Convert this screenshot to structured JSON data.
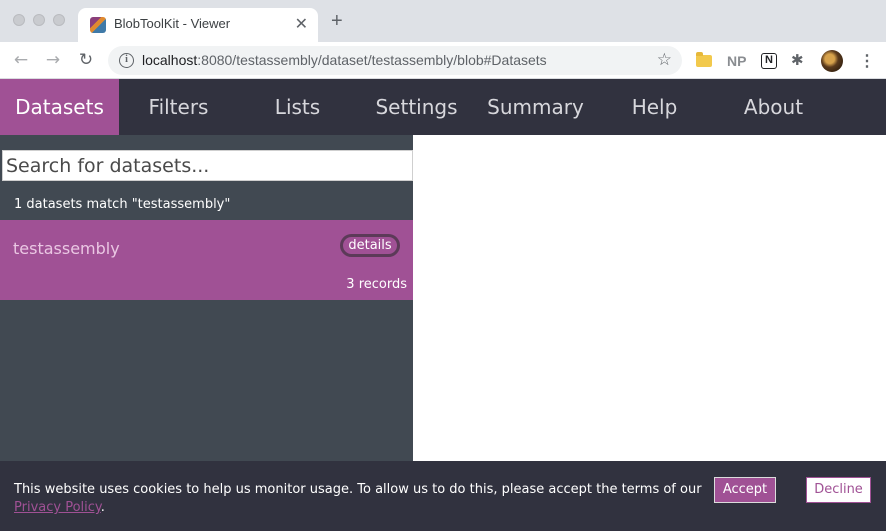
{
  "browser": {
    "tab_title": "BlobToolKit - Viewer",
    "tab_close": "✕",
    "new_tab": "+",
    "url_host": "localhost",
    "url_rest": ":8080/testassembly/dataset/testassembly/blob#Datasets",
    "back": "←",
    "forward": "→",
    "reload": "↻",
    "info": "i",
    "star": "☆",
    "extensions": {
      "np_label": "NP",
      "notion_label": "N",
      "puzzle": "✱",
      "menu": "⋮"
    }
  },
  "nav": {
    "items": [
      {
        "label": "Datasets"
      },
      {
        "label": "Filters"
      },
      {
        "label": "Lists"
      },
      {
        "label": "Settings"
      },
      {
        "label": "Summary"
      },
      {
        "label": "Help"
      },
      {
        "label": "About"
      }
    ],
    "active_color": "#a05195"
  },
  "sidebar": {
    "search_placeholder": "Search for datasets...",
    "match_text": "1 datasets match \"testassembly\"",
    "dataset": {
      "name": "testassembly",
      "details_label": "details",
      "records": "3 records"
    }
  },
  "cookie": {
    "text": "This website uses cookies to help us monitor usage. To allow us to do this, please accept the terms of our",
    "link": "Privacy Policy",
    "link_suffix": ".",
    "accept_label": "Accept",
    "decline_label": "Decline"
  },
  "colors": {
    "nav_bg": "#31323f",
    "sidebar_bg": "#414952",
    "accent": "#a05195"
  }
}
